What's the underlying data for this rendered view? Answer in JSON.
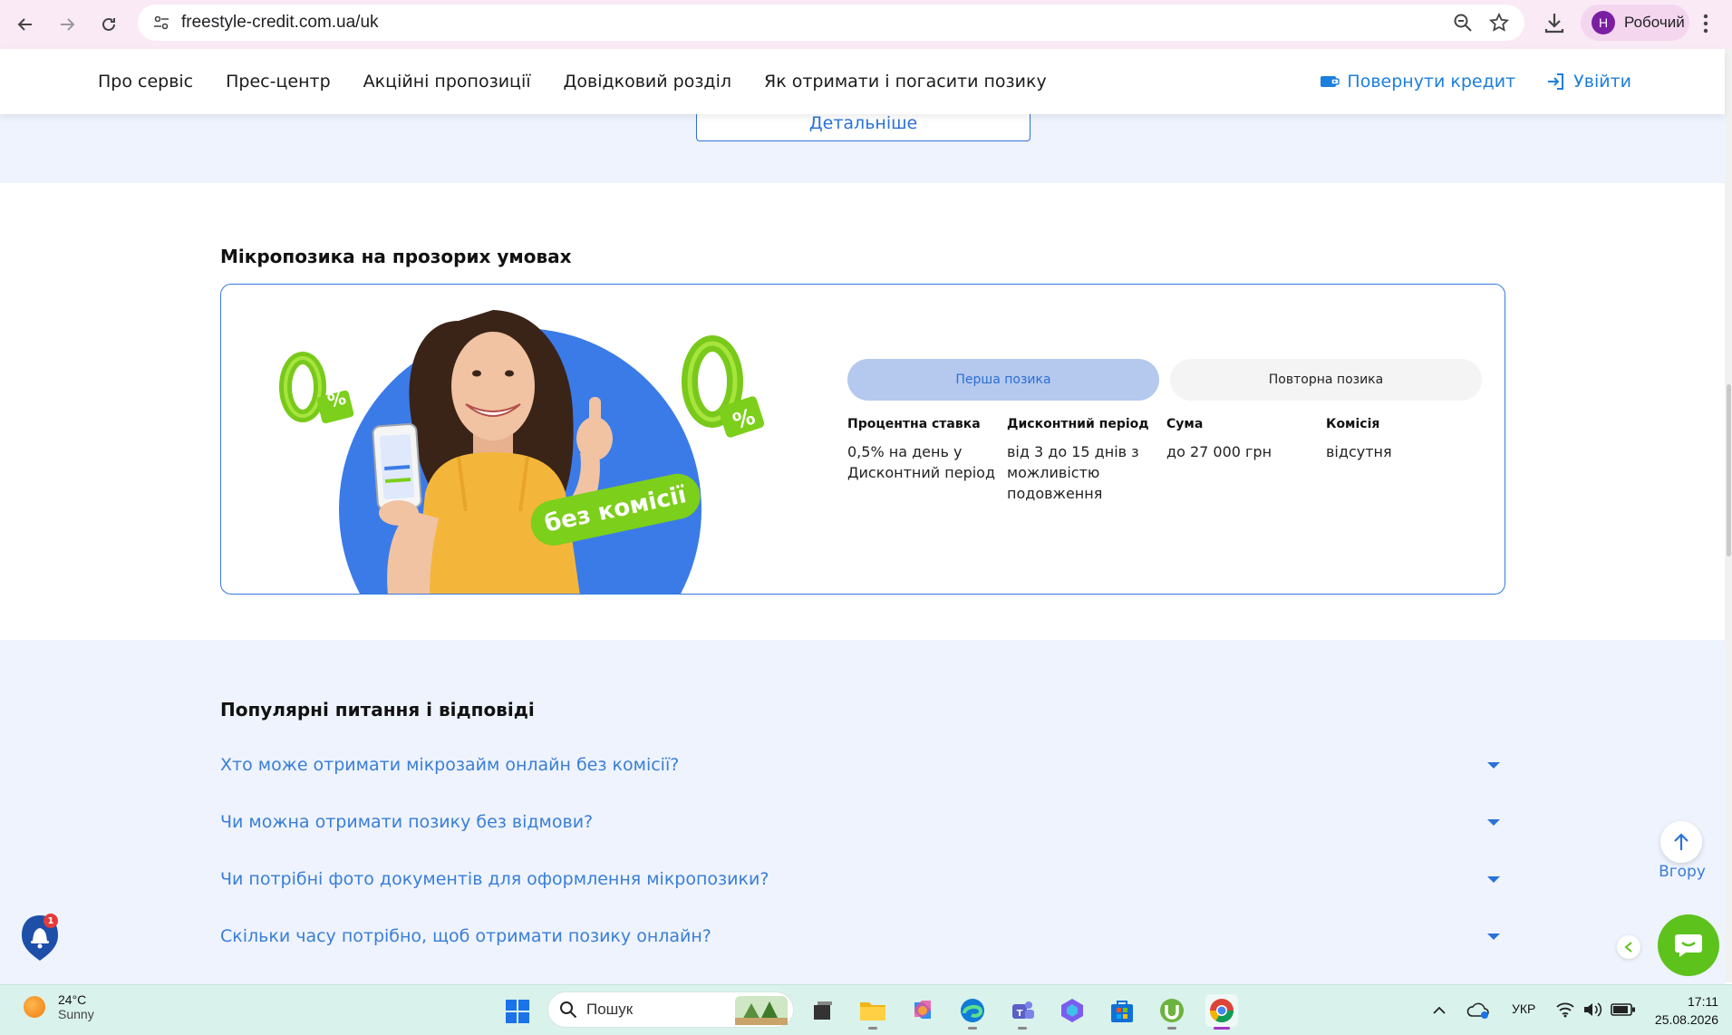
{
  "browser": {
    "url": "freestyle-credit.com.ua/uk",
    "profile_initial": "Н",
    "profile_name": "Робочий"
  },
  "header": {
    "nav": [
      "Про сервіс",
      "Прес-центр",
      "Акційні пропозиції",
      "Довідковий розділ",
      "Як отримати і погасити позику"
    ],
    "repay_label": "Повернути кредит",
    "login_label": "Увійти"
  },
  "details_button": "Детальніше",
  "loan_section": {
    "title": "Мікропозика на прозорих умовах",
    "promo_badge": "без комісії",
    "promo_zero": "0",
    "promo_percent": "%",
    "tabs": {
      "first": "Перша позика",
      "repeat": "Повторна позика",
      "active": "first"
    },
    "terms": [
      {
        "key": "Процентна ставка",
        "value": "0,5% на день у Дисконтний період"
      },
      {
        "key": "Дисконтний період",
        "value": "від 3 до 15 днів з можливістю подовження"
      },
      {
        "key": "Сума",
        "value": "до 27 000 грн"
      },
      {
        "key": "Комісія",
        "value": "відсутня"
      }
    ]
  },
  "faq": {
    "title": "Популярні питання і відповіді",
    "items": [
      "Хто може отримати мікрозайм онлайн без комісії?",
      "Чи можна отримати позику без відмови?",
      "Чи потрібні фото документів для оформлення мікропозики?",
      "Скільки часу потрібно, щоб отримати позику онлайн?"
    ]
  },
  "floating": {
    "to_top_label": "Вгору",
    "notification_count": "1"
  },
  "taskbar": {
    "weather_temp": "24°C",
    "weather_desc": "Sunny",
    "search_placeholder": "Пошук",
    "language": "УКР",
    "time": "17:11",
    "date": "25.08.2026"
  },
  "colors": {
    "accent_blue": "#2a73d6",
    "light_band": "#eef3fd",
    "promo_circle": "#3b7be8",
    "promo_green": "#7ccf1a",
    "chat_green": "#5ec21d"
  }
}
